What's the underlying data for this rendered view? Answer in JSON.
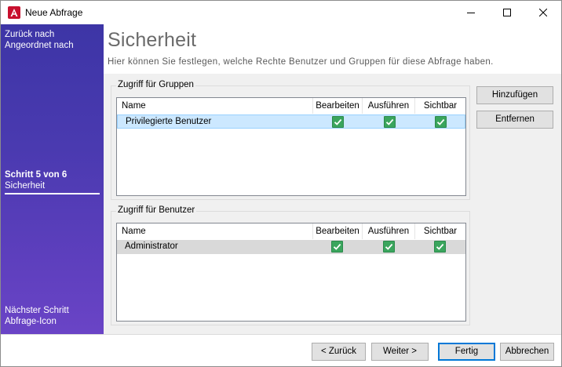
{
  "window": {
    "title": "Neue Abfrage",
    "app_icon": "access-icon",
    "controls": [
      "minimize-icon",
      "maximize-icon",
      "close-icon"
    ]
  },
  "sidebar": {
    "back_line1": "Zurück nach",
    "back_line2": "Angeordnet nach",
    "current_step": "Schritt 5 von 6",
    "current_step_name": "Sicherheit",
    "next_line1": "Nächster Schritt",
    "next_line2": "Abfrage-Icon"
  },
  "page": {
    "title": "Sicherheit",
    "description": "Hier können Sie festlegen, welche Rechte Benutzer und Gruppen für diese Abfrage haben."
  },
  "groups_section": {
    "label": "Zugriff für Gruppen",
    "columns": [
      "Name",
      "Bearbeiten",
      "Ausführen",
      "Sichtbar"
    ],
    "rows": [
      {
        "name": "Privilegierte Benutzer",
        "bearbeiten": true,
        "ausfuehren": true,
        "sichtbar": true
      }
    ]
  },
  "users_section": {
    "label": "Zugriff für Benutzer",
    "columns": [
      "Name",
      "Bearbeiten",
      "Ausführen",
      "Sichtbar"
    ],
    "rows": [
      {
        "name": "Administrator",
        "bearbeiten": true,
        "ausfuehren": true,
        "sichtbar": true
      }
    ]
  },
  "side_buttons": {
    "add": "Hinzufügen",
    "remove": "Entfernen"
  },
  "footer_buttons": {
    "back": "< Zurück",
    "next": "Weiter >",
    "finish": "Fertig",
    "cancel": "Abbrechen"
  },
  "colors": {
    "sidebar_top": "#3d35a6",
    "sidebar_bottom": "#6a44c6",
    "selection": "#cce8ff",
    "checkbox": "#3aa55d",
    "default_button_border": "#0078d7"
  }
}
